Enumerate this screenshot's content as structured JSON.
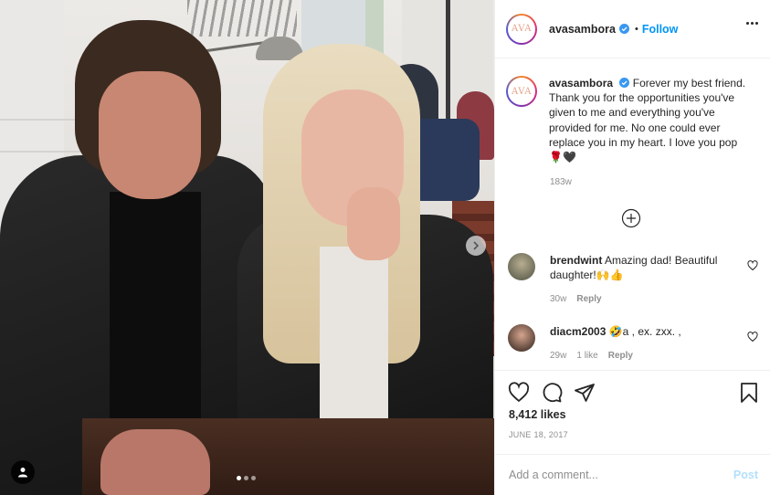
{
  "post": {
    "username": "avasambora",
    "avatar_text": "AVA",
    "follow_label": "Follow",
    "bullet": "•",
    "caption": "Forever my best friend. Thank you for the opportunities you've given to me and everything you've provided for me. No one could ever replace you in my heart. I love you pop 🌹🖤",
    "caption_age": "183w",
    "likes": "8,412 likes",
    "date": "JUNE 18, 2017"
  },
  "carousel": {
    "slide_count": 3,
    "active_index": 0
  },
  "comments": [
    {
      "username": "brendwint",
      "text": "Amazing dad! Beautiful daughter!🙌👍",
      "age": "30w",
      "likes_label": "",
      "reply_label": "Reply"
    },
    {
      "username": "diacm2003",
      "text": "🤣a , ex. zxx. ,",
      "age": "29w",
      "likes_label": "1 like",
      "reply_label": "Reply"
    }
  ],
  "add_comment": {
    "placeholder": "Add a comment...",
    "post_label": "Post"
  },
  "icons": {
    "more": "more-options-icon",
    "verified": "verified-badge-icon",
    "load_more": "load-more-comments-icon",
    "like": "heart-icon",
    "comment": "comment-icon",
    "share": "share-icon",
    "save": "bookmark-icon",
    "next": "chevron-right-icon",
    "tag": "user-tag-icon"
  },
  "colors": {
    "link": "#0095f6",
    "post_disabled": "#b2dffc",
    "muted": "#8e8e8e",
    "text": "#262626"
  }
}
